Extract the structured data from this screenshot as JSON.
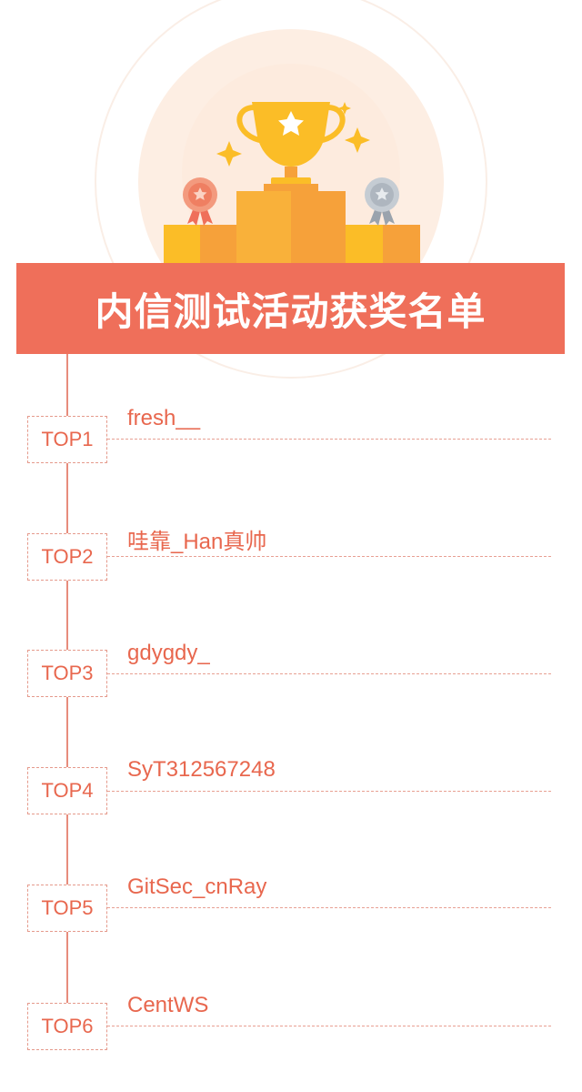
{
  "banner": {
    "title": "内信测试活动获奖名单"
  },
  "winners": [
    {
      "rank": "TOP1",
      "name": "fresh__"
    },
    {
      "rank": "TOP2",
      "name": "哇靠_Han真帅"
    },
    {
      "rank": "TOP3",
      "name": "gdygdy_"
    },
    {
      "rank": "TOP4",
      "name": "SyT312567248"
    },
    {
      "rank": "TOP5",
      "name": "GitSec_cnRay"
    },
    {
      "rank": "TOP6",
      "name": "CentWS"
    }
  ],
  "icons": {
    "hero": "trophy-icon",
    "left_medal": "bronze-medal-icon",
    "right_medal": "silver-medal-icon",
    "sparkles": "sparkle-icon"
  },
  "colors": {
    "accent": "#ef6f5a",
    "text": "#e8674e",
    "gold": "#fbbd27",
    "orange": "#f6a13a"
  }
}
